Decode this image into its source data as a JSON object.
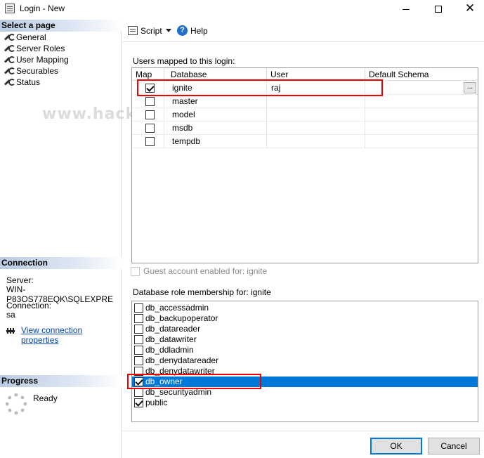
{
  "window": {
    "title": "Login - New",
    "controls": {
      "minimize": "minimize",
      "maximize": "maximize",
      "close": "✕"
    }
  },
  "sidebar": {
    "select_header": "Select a page",
    "pages": [
      {
        "label": "General"
      },
      {
        "label": "Server Roles"
      },
      {
        "label": "User Mapping"
      },
      {
        "label": "Securables"
      },
      {
        "label": "Status"
      }
    ],
    "connection_header": "Connection",
    "server_label": "Server:",
    "server_value": "WIN-P83OS778EQK\\SQLEXPRE",
    "connection_label": "Connection:",
    "connection_value": "sa",
    "view_props_link": "View connection properties",
    "progress_header": "Progress",
    "progress_status": "Ready"
  },
  "toolbar": {
    "script_label": "Script",
    "help_label": "Help"
  },
  "users_mapped": {
    "label": "Users mapped to this login:",
    "columns": [
      "Map",
      "Database",
      "User",
      "Default Schema"
    ],
    "rows": [
      {
        "map": true,
        "database": "ignite",
        "user": "raj",
        "schema": ""
      },
      {
        "map": false,
        "database": "master",
        "user": "",
        "schema": ""
      },
      {
        "map": false,
        "database": "model",
        "user": "",
        "schema": ""
      },
      {
        "map": false,
        "database": "msdb",
        "user": "",
        "schema": ""
      },
      {
        "map": false,
        "database": "tempdb",
        "user": "",
        "schema": ""
      }
    ],
    "ellipsis": "..."
  },
  "guest": {
    "label": "Guest account enabled for: ignite",
    "checked": false
  },
  "roles": {
    "label": "Database role membership for: ignite",
    "items": [
      {
        "name": "db_accessadmin",
        "checked": false
      },
      {
        "name": "db_backupoperator",
        "checked": false
      },
      {
        "name": "db_datareader",
        "checked": false
      },
      {
        "name": "db_datawriter",
        "checked": false
      },
      {
        "name": "db_ddladmin",
        "checked": false
      },
      {
        "name": "db_denydatareader",
        "checked": false
      },
      {
        "name": "db_denydatawriter",
        "checked": false
      },
      {
        "name": "db_owner",
        "checked": true,
        "selected": true
      },
      {
        "name": "db_securityadmin",
        "checked": false
      },
      {
        "name": "public",
        "checked": true
      }
    ]
  },
  "footer": {
    "ok_label": "OK",
    "cancel_label": "Cancel"
  },
  "watermark": "www.hackingarticles.in",
  "colors": {
    "selection": "#0078d7",
    "highlight_box": "#e00000",
    "link": "#0645ad"
  }
}
